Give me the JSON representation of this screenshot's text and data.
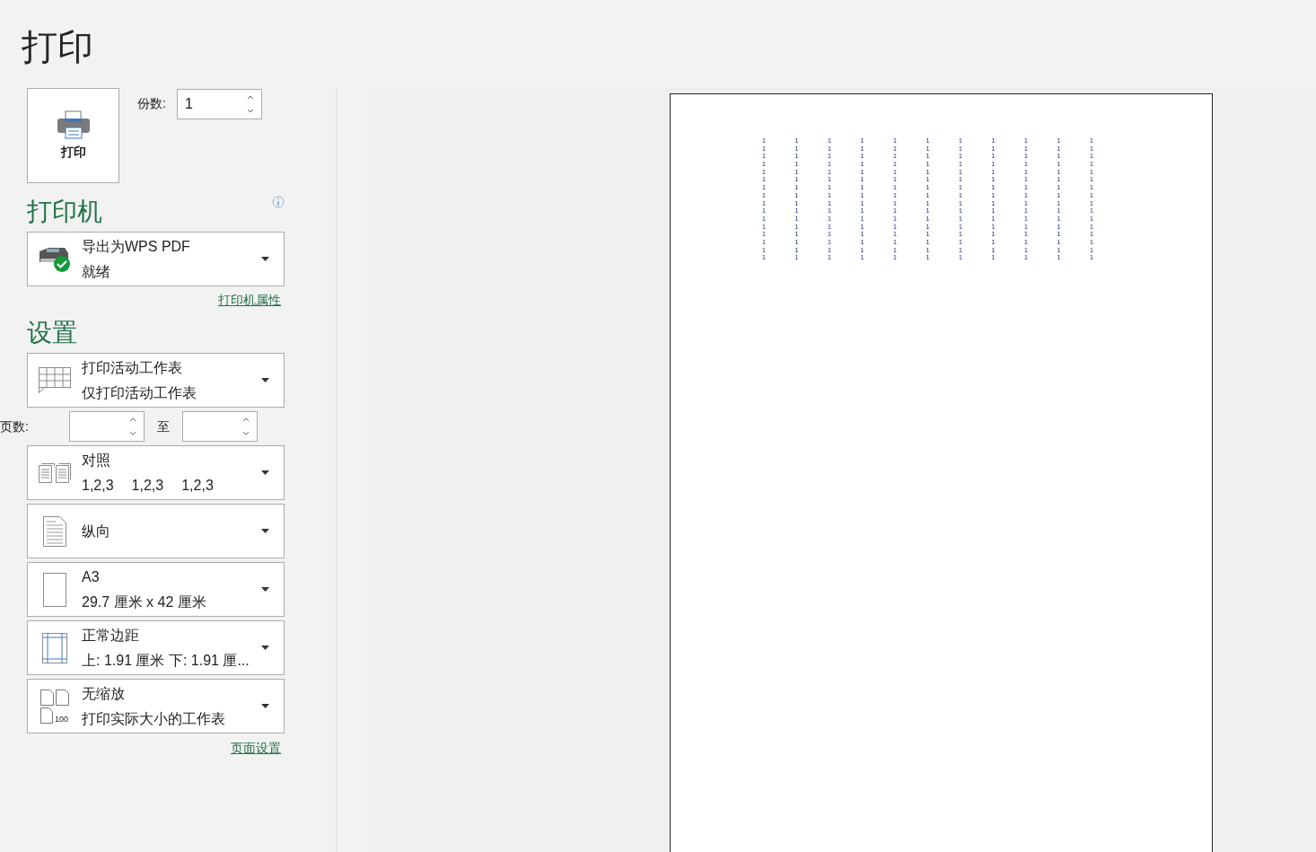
{
  "title": "打印",
  "print_button": {
    "label": "打印"
  },
  "copies": {
    "label": "份数:",
    "value": "1"
  },
  "printer": {
    "heading": "打印机",
    "name": "导出为WPS PDF",
    "status": "就绪",
    "properties_link": "打印机属性"
  },
  "settings": {
    "heading": "设置",
    "dropdowns": [
      {
        "kind": "sheet",
        "lines": [
          "打印活动工作表",
          "仅打印活动工作表"
        ]
      },
      {
        "kind": "pages"
      },
      {
        "kind": "collate",
        "lines": [
          "对照",
          "1,2,3",
          "1,2,3",
          "1,2,3"
        ]
      },
      {
        "kind": "portrait",
        "lines": [
          "纵向"
        ]
      },
      {
        "kind": "paper",
        "lines": [
          "A3",
          "29.7 厘米 x 42 厘米"
        ]
      },
      {
        "kind": "margins",
        "lines": [
          "正常边距",
          "上: 1.91 厘米 下: 1.91 厘..."
        ]
      },
      {
        "kind": "scaling",
        "lines": [
          "无缩放",
          "打印实际大小的工作表"
        ],
        "icon_text": "100"
      }
    ],
    "pages": {
      "label": "页数:",
      "to": "至"
    },
    "page_setup_link": "页面设置"
  },
  "preview": {
    "rows": [
      [
        "1",
        "1",
        "1",
        "1",
        "1",
        "1",
        "1",
        "1",
        "1",
        "1",
        "1"
      ],
      [
        "1",
        "1",
        "1",
        "1",
        "1",
        "1",
        "1",
        "1",
        "1",
        "1",
        "1"
      ],
      [
        "1",
        "1",
        "1",
        "1",
        "1",
        "1",
        "1",
        "1",
        "1",
        "1",
        "1"
      ],
      [
        "1",
        "1",
        "1",
        "1",
        "1",
        "1",
        "1",
        "1",
        "1",
        "1",
        "1"
      ],
      [
        "1",
        "1",
        "1",
        "1",
        "1",
        "1",
        "1",
        "1",
        "1",
        "1",
        "1"
      ],
      [
        "1",
        "1",
        "1",
        "1",
        "1",
        "1",
        "1",
        "1",
        "1",
        "1",
        "1"
      ],
      [
        "1",
        "1",
        "1",
        "1",
        "1",
        "1",
        "1",
        "1",
        "1",
        "1",
        "1"
      ],
      [
        "1",
        "1",
        "1",
        "1",
        "1",
        "1",
        "1",
        "1",
        "1",
        "1",
        "1"
      ],
      [
        "1",
        "1",
        "1",
        "1",
        "1",
        "1",
        "1",
        "1",
        "1",
        "1",
        "1"
      ],
      [
        "1",
        "1",
        "1",
        "1",
        "1",
        "1",
        "1",
        "1",
        "1",
        "1",
        "1"
      ],
      [
        "1",
        "1",
        "1",
        "1",
        "1",
        "1",
        "1",
        "1",
        "1",
        "1",
        "1"
      ],
      [
        "1",
        "1",
        "1",
        "1",
        "1",
        "1",
        "1",
        "1",
        "1",
        "1",
        "1"
      ],
      [
        "1",
        "1",
        "1",
        "1",
        "1",
        "1",
        "1",
        "1",
        "1",
        "1",
        "1"
      ],
      [
        "1",
        "1",
        "1",
        "1",
        "1",
        "1",
        "1",
        "1",
        "1",
        "1",
        "1"
      ],
      [
        "1",
        "1",
        "1",
        "1",
        "1",
        "1",
        "1",
        "1",
        "1",
        "1",
        "1"
      ],
      [
        "1",
        "1",
        "1",
        "1",
        "1",
        "1",
        "1",
        "1",
        "1",
        "1",
        "1"
      ]
    ]
  }
}
